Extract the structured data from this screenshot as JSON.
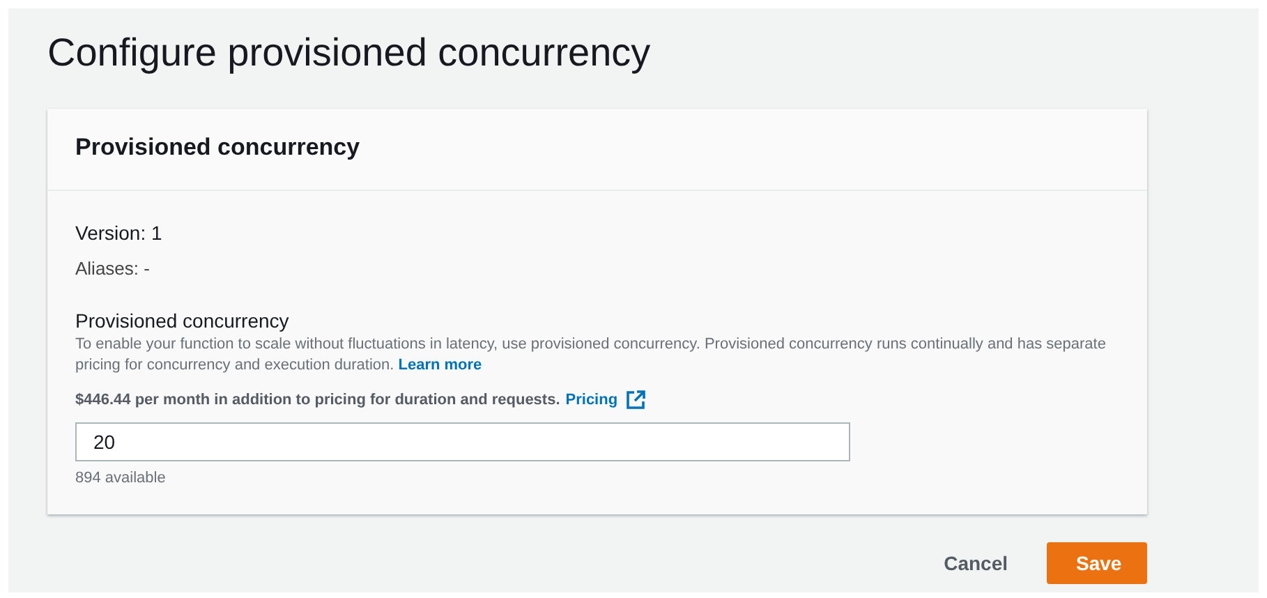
{
  "page": {
    "title": "Configure provisioned concurrency"
  },
  "panel": {
    "title": "Provisioned concurrency",
    "version": "Version: 1",
    "aliases": "Aliases: -",
    "field": {
      "label": "Provisioned concurrency",
      "description": "To enable your function to scale without fluctuations in latency, use provisioned concurrency. Provisioned concurrency runs continually and has separate pricing for concurrency and execution duration.",
      "description_link": "Learn more",
      "pricing_note": "$446.44 per month in addition to pricing for duration and requests.",
      "pricing_link": "Pricing",
      "value": "20",
      "hint": "894 available"
    }
  },
  "buttons": [
    {
      "label": "Cancel",
      "kind": "link"
    },
    {
      "label": "Save",
      "kind": "primary"
    }
  ]
}
